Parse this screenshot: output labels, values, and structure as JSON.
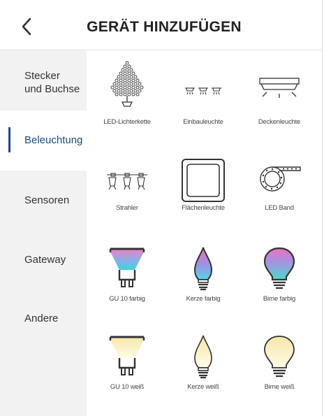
{
  "header": {
    "title": "GERÄT HINZUFÜGEN"
  },
  "sidebar": {
    "items": [
      {
        "label": "Stecker\nund Buchse"
      },
      {
        "label": "Beleuchtung"
      },
      {
        "label": "Sensoren"
      },
      {
        "label": "Gateway"
      },
      {
        "label": "Andere"
      }
    ],
    "active_index": 1,
    "accent_color": "#1a4a8a"
  },
  "devices": [
    {
      "label": "LED-Lichterkette",
      "icon": "led-string-icon"
    },
    {
      "label": "Einbauleuchte",
      "icon": "recessed-light-icon"
    },
    {
      "label": "Deckenleuchte",
      "icon": "ceiling-light-icon"
    },
    {
      "label": "Strahler",
      "icon": "spotlight-icon"
    },
    {
      "label": "Flächenleuchte",
      "icon": "panel-light-icon"
    },
    {
      "label": "LED Band",
      "icon": "led-strip-icon"
    },
    {
      "label": "GU 10 farbig",
      "icon": "gu10-color-icon"
    },
    {
      "label": "Kerze farbig",
      "icon": "candle-color-icon"
    },
    {
      "label": "Birne farbig",
      "icon": "bulb-color-icon"
    },
    {
      "label": "GU 10 weiß",
      "icon": "gu10-white-icon"
    },
    {
      "label": "Kerze weiß",
      "icon": "candle-white-icon"
    },
    {
      "label": "Birne weiß",
      "icon": "bulb-white-icon"
    }
  ]
}
